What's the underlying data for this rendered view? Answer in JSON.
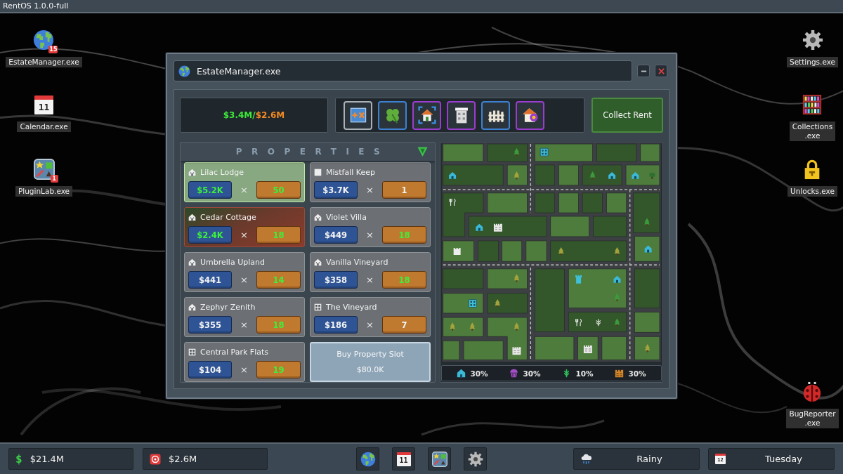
{
  "top_bar": {
    "title": "RentOS 1.0.0-full"
  },
  "desktop_left": [
    {
      "label": "EstateManager.exe",
      "kind": "globe",
      "badge": "15"
    },
    {
      "label": "Calendar.exe",
      "kind": "calendar",
      "icon_text": "11"
    },
    {
      "label": "PluginLab.exe",
      "kind": "pluginlab",
      "badge": "1"
    }
  ],
  "desktop_right": [
    {
      "label": "Settings.exe",
      "kind": "gear"
    },
    {
      "label": "Collections\n.exe",
      "kind": "bookshelf"
    },
    {
      "label": "Unlocks.exe",
      "kind": "lock"
    },
    {
      "label": "BugReporter\n.exe",
      "kind": "ladybug"
    }
  ],
  "window": {
    "title": "EstateManager.exe",
    "controls": [
      {
        "kind": "minimize"
      },
      {
        "kind": "close"
      }
    ],
    "balance": {
      "income": "$3.4M/",
      "expense": "$2.6M"
    },
    "upgrades": [
      {
        "kind": "plus-times",
        "color": "#aab1b7"
      },
      {
        "kind": "clover",
        "color": "#3d82d2"
      },
      {
        "kind": "house-target",
        "color": "#9a3ccf"
      },
      {
        "kind": "building",
        "color": "#9a3ccf"
      },
      {
        "kind": "fence",
        "color": "#3d82d2"
      },
      {
        "kind": "house-key",
        "color": "#9a3ccf"
      }
    ],
    "collect_button": "Collect Rent",
    "properties": {
      "title": "PROPERTIES",
      "cards": [
        {
          "name": "Lilac Lodge",
          "kind": "house",
          "price": "$5.2K",
          "price_boosted": true,
          "operator": "×",
          "count": "50",
          "count_boosted": true,
          "bonus": true,
          "penalty": false
        },
        {
          "name": "Mistfall Keep",
          "kind": "keep",
          "price": "$3.7K",
          "price_boosted": false,
          "operator": "×",
          "count": "1",
          "count_boosted": false,
          "bonus": false,
          "penalty": false
        },
        {
          "name": "Cedar Cottage",
          "kind": "house",
          "price": "$2.4K",
          "price_boosted": true,
          "operator": "×",
          "count": "18",
          "count_boosted": true,
          "bonus": false,
          "penalty": true
        },
        {
          "name": "Violet Villa",
          "kind": "house",
          "price": "$449",
          "price_boosted": false,
          "operator": "×",
          "count": "18",
          "count_boosted": true,
          "bonus": false,
          "penalty": false
        },
        {
          "name": "Umbrella Upland",
          "kind": "house",
          "price": "$441",
          "price_boosted": false,
          "operator": "×",
          "count": "14",
          "count_boosted": true,
          "bonus": false,
          "penalty": false
        },
        {
          "name": "Vanilla Vineyard",
          "kind": "house",
          "price": "$358",
          "price_boosted": false,
          "operator": "×",
          "count": "18",
          "count_boosted": true,
          "bonus": false,
          "penalty": false
        },
        {
          "name": "Zephyr Zenith",
          "kind": "house",
          "price": "$355",
          "price_boosted": false,
          "operator": "×",
          "count": "18",
          "count_boosted": true,
          "bonus": false,
          "penalty": false
        },
        {
          "name": "The Vineyard",
          "kind": "flats",
          "price": "$186",
          "price_boosted": false,
          "operator": "×",
          "count": "7",
          "count_boosted": false,
          "bonus": false,
          "penalty": false
        },
        {
          "name": "Central Park Flats",
          "kind": "flats",
          "price": "$104",
          "price_boosted": false,
          "operator": "×",
          "count": "19",
          "count_boosted": true,
          "bonus": false,
          "penalty": false
        }
      ],
      "buy_slot": {
        "label": "Buy Property Slot",
        "price": "$80.0K"
      }
    },
    "map": {
      "legend": [
        {
          "kind": "house",
          "color": "#3bb9d6",
          "value": "30%"
        },
        {
          "kind": "cupcake",
          "color": "#a24fc4",
          "value": "30%"
        },
        {
          "kind": "wheat",
          "color": "#2fc35a",
          "value": "10%"
        },
        {
          "kind": "factory",
          "color": "#d4862a",
          "value": "30%"
        }
      ]
    }
  },
  "taskbar": {
    "cash": {
      "symbol": "$",
      "value": "$21.4M"
    },
    "expenses": {
      "value": "$2.6M"
    },
    "apps": [
      {
        "kind": "globe"
      },
      {
        "kind": "calendar",
        "icon_text": "11"
      },
      {
        "kind": "pluginlab"
      },
      {
        "kind": "gear"
      }
    ],
    "weather": {
      "kind": "rain-cloud",
      "label": "Rainy"
    },
    "day": {
      "icon_text": "12",
      "label": "Tuesday"
    }
  }
}
